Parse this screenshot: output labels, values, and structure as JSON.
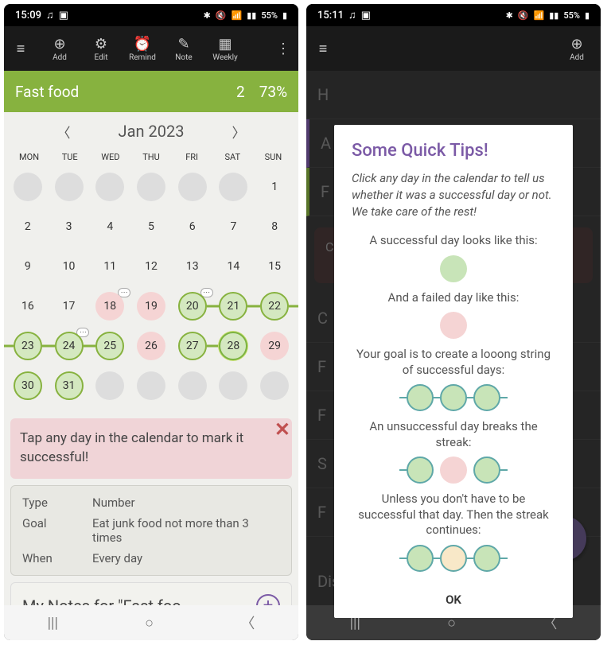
{
  "status": {
    "time1": "15:09",
    "time2": "15:11",
    "battery": "55%",
    "signal_icons": "⚡ ⚹ ⋮ ⋮"
  },
  "toolbar": {
    "menu": "≡",
    "add": "Add",
    "edit": "Edit",
    "remind": "Remind",
    "note": "Note",
    "weekly": "Weekly",
    "more": "⋮"
  },
  "habit": {
    "name": "Fast food",
    "count": "2",
    "percent": "73%"
  },
  "calendar": {
    "month": "Jan 2023",
    "days": [
      "MON",
      "TUE",
      "WED",
      "THU",
      "FRI",
      "SAT",
      "SUN"
    ],
    "cells": [
      {
        "n": "",
        "t": "grey"
      },
      {
        "n": "",
        "t": "grey"
      },
      {
        "n": "",
        "t": "grey"
      },
      {
        "n": "",
        "t": "grey"
      },
      {
        "n": "",
        "t": "grey"
      },
      {
        "n": "",
        "t": "grey"
      },
      {
        "n": "1",
        "t": "plain"
      },
      {
        "n": "2",
        "t": "plain"
      },
      {
        "n": "3",
        "t": "plain"
      },
      {
        "n": "4",
        "t": "plain"
      },
      {
        "n": "5",
        "t": "plain"
      },
      {
        "n": "6",
        "t": "plain"
      },
      {
        "n": "7",
        "t": "plain"
      },
      {
        "n": "8",
        "t": "plain"
      },
      {
        "n": "9",
        "t": "plain"
      },
      {
        "n": "10",
        "t": "plain"
      },
      {
        "n": "11",
        "t": "plain"
      },
      {
        "n": "12",
        "t": "plain"
      },
      {
        "n": "13",
        "t": "plain"
      },
      {
        "n": "14",
        "t": "plain"
      },
      {
        "n": "15",
        "t": "plain"
      },
      {
        "n": "16",
        "t": "plain"
      },
      {
        "n": "17",
        "t": "plain"
      },
      {
        "n": "18",
        "t": "fail",
        "note": true
      },
      {
        "n": "19",
        "t": "fail"
      },
      {
        "n": "20",
        "t": "success",
        "note": true,
        "lr": true
      },
      {
        "n": "21",
        "t": "success",
        "ll": true,
        "lr": true
      },
      {
        "n": "22",
        "t": "success",
        "ll": true,
        "lr": true
      },
      {
        "n": "23",
        "t": "success",
        "ll": true,
        "lr": true
      },
      {
        "n": "24",
        "t": "success",
        "ll": true,
        "lr": true,
        "note": true
      },
      {
        "n": "25",
        "t": "success",
        "ll": true
      },
      {
        "n": "26",
        "t": "fail"
      },
      {
        "n": "27",
        "t": "success",
        "lr": true
      },
      {
        "n": "28",
        "t": "success-bright",
        "ll": true
      },
      {
        "n": "29",
        "t": "fail"
      },
      {
        "n": "30",
        "t": "success"
      },
      {
        "n": "31",
        "t": "success"
      },
      {
        "n": "",
        "t": "grey"
      },
      {
        "n": "",
        "t": "grey"
      },
      {
        "n": "",
        "t": "grey"
      },
      {
        "n": "",
        "t": "grey"
      },
      {
        "n": "",
        "t": "grey"
      }
    ]
  },
  "tip": {
    "text": "Tap any day in the calendar to mark it successful!"
  },
  "info": {
    "type_label": "Type",
    "type_value": "Number",
    "goal_label": "Goal",
    "goal_value": "Eat junk food not more than 3 times",
    "when_label": "When",
    "when_value": "Every day"
  },
  "notes": {
    "title": "My Notes for \"Fast foo..."
  },
  "modal": {
    "title": "Some Quick Tips!",
    "intro": "Click any day in the calendar to tell us whether it was a successful day or not. We take care of the rest!",
    "line1": "A successful day looks like this:",
    "line2": "And a failed day like this:",
    "line3": "Your goal is to create a looong string of successful days:",
    "line4": "An unsuccessful day breaks the streak:",
    "line5": "Unless you don't have to be successful that day. Then the streak continues:",
    "ok": "OK"
  },
  "screen2": {
    "header": "H",
    "item_a": "A",
    "item_f": "F",
    "card_text": "C\nha\nto",
    "disclaimer": "Disclaimer",
    "more_letters": [
      "C",
      "F",
      "F",
      "S",
      "F"
    ]
  }
}
